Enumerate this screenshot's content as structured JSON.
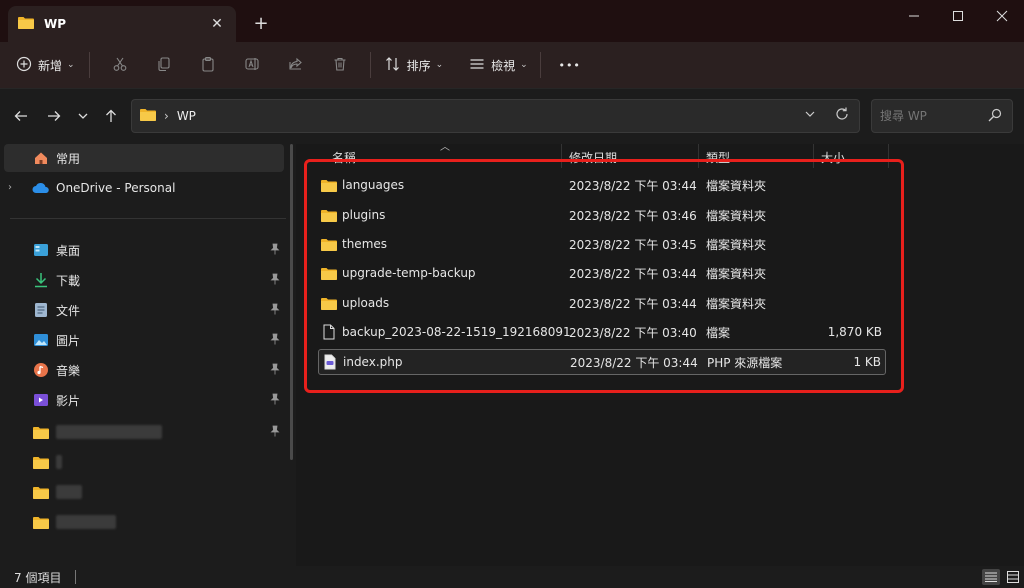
{
  "tab": {
    "title": "WP"
  },
  "toolbar": {
    "new_label": "新增",
    "sort_label": "排序",
    "view_label": "檢視",
    "more_label": "•••"
  },
  "address": {
    "crumb": "WP",
    "search_placeholder": "搜尋 WP"
  },
  "sidebar": {
    "home": "常用",
    "onedrive": "OneDrive - Personal",
    "desktop": "桌面",
    "downloads": "下載",
    "documents": "文件",
    "pictures": "圖片",
    "music": "音樂",
    "videos": "影片"
  },
  "columns": {
    "name": "名稱",
    "date": "修改日期",
    "type": "類型",
    "size": "大小"
  },
  "files": [
    {
      "name": "languages",
      "date": "2023/8/22 下午 03:44",
      "type": "檔案資料夾",
      "size": "",
      "kind": "folder"
    },
    {
      "name": "plugins",
      "date": "2023/8/22 下午 03:46",
      "type": "檔案資料夾",
      "size": "",
      "kind": "folder"
    },
    {
      "name": "themes",
      "date": "2023/8/22 下午 03:45",
      "type": "檔案資料夾",
      "size": "",
      "kind": "folder"
    },
    {
      "name": "upgrade-temp-backup",
      "date": "2023/8/22 下午 03:44",
      "type": "檔案資料夾",
      "size": "",
      "kind": "folder"
    },
    {
      "name": "uploads",
      "date": "2023/8/22 下午 03:44",
      "type": "檔案資料夾",
      "size": "",
      "kind": "folder"
    },
    {
      "name": "backup_2023-08-22-1519_192168091...",
      "date": "2023/8/22 下午 03:40",
      "type": "檔案",
      "size": "1,870 KB",
      "kind": "file"
    },
    {
      "name": "index.php",
      "date": "2023/8/22 下午 03:44",
      "type": "PHP 來源檔案",
      "size": "1 KB",
      "kind": "php"
    }
  ],
  "status": {
    "count": "7 個項目"
  },
  "colors": {
    "accent_highlight": "#e8201c",
    "folder": "#f0b429"
  }
}
